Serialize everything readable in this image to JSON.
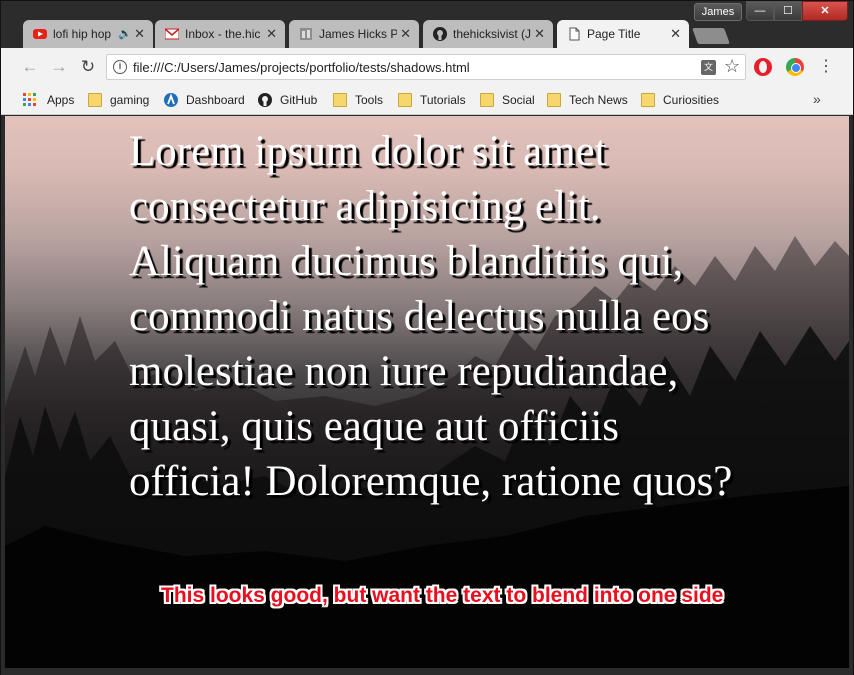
{
  "titlebar": {
    "user": "James",
    "minimize": "—",
    "maximize": "☐",
    "close": "✕"
  },
  "tabs": [
    {
      "label": "lofi hip hop",
      "icon": "youtube-icon",
      "audio": "🔊",
      "close": "✕"
    },
    {
      "label": "Inbox - the.hic",
      "icon": "gmail-icon",
      "close": "✕"
    },
    {
      "label": "James Hicks P",
      "icon": "portfolio-icon",
      "close": "✕"
    },
    {
      "label": "thehicksivist (J",
      "icon": "github-icon",
      "close": "✕"
    },
    {
      "label": "Page Title",
      "icon": "page-icon",
      "close": "✕",
      "active": true
    }
  ],
  "toolbar": {
    "back": "←",
    "forward": "→",
    "reload": "↻",
    "url": "file:///C:/Users/James/projects/portfolio/tests/shadows.html",
    "info": "i",
    "star": "☆",
    "menu": "⋮"
  },
  "bookmarks": [
    {
      "label": "Apps",
      "icon": "apps-icon"
    },
    {
      "label": "gaming",
      "icon": "folder-icon"
    },
    {
      "label": "Dashboard",
      "icon": "dashboard-icon"
    },
    {
      "label": "GitHub",
      "icon": "github-icon"
    },
    {
      "label": "Tools",
      "icon": "folder-icon"
    },
    {
      "label": "Tutorials",
      "icon": "folder-icon"
    },
    {
      "label": "Social",
      "icon": "folder-icon"
    },
    {
      "label": "Tech News",
      "icon": "folder-icon"
    },
    {
      "label": "Curiosities",
      "icon": "folder-icon"
    }
  ],
  "bookmarks_more": "»",
  "page": {
    "text": "Lorem ipsum dolor sit amet consectetur adipisicing elit. Aliquam ducimus blanditiis qui, commodi natus delectus nulla eos molestiae non iure repudiandae, quasi, quis eaque aut officiis officia! Doloremque, ratione quos?",
    "annotation": "This looks good, but want the text to blend into one side"
  },
  "colors": {
    "annotation": "#e8101e",
    "text": "#ffffff",
    "shadow": "#000000"
  }
}
